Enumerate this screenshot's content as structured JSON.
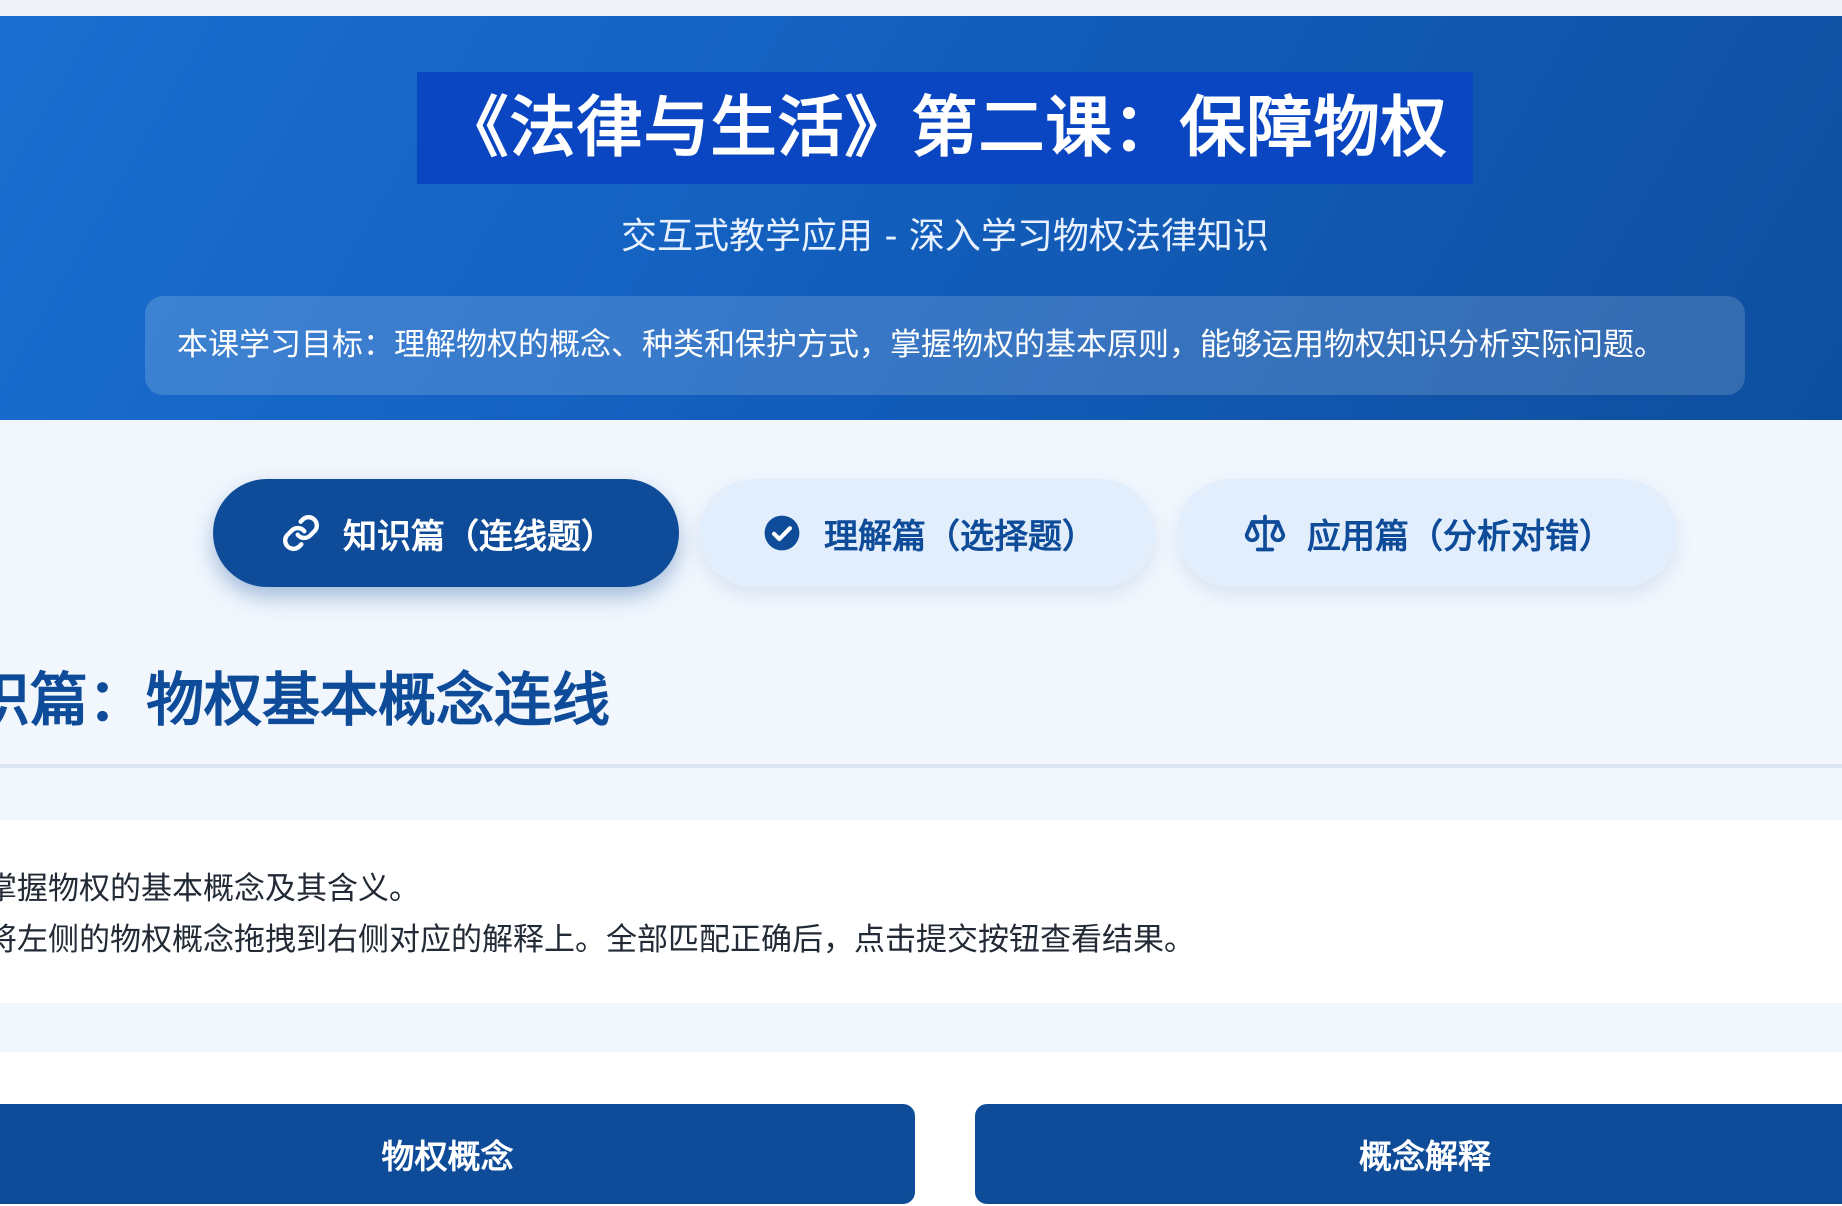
{
  "header": {
    "title": "《法律与生活》第二课：保障物权",
    "subtitle": "交互式教学应用 - 深入学习物权法律知识",
    "goal": "本课学习目标：理解物权的概念、种类和保护方式，掌握物权的基本原则，能够运用物权知识分析实际问题。"
  },
  "tabs": [
    {
      "label": "知识篇（连线题）",
      "icon": "link-icon",
      "active": true
    },
    {
      "label": "理解篇（选择题）",
      "icon": "check-circle-icon",
      "active": false
    },
    {
      "label": "应用篇（分析对错）",
      "icon": "scale-icon",
      "active": false
    }
  ],
  "section": {
    "title": "识篇：物权基本概念连线",
    "instruction_lines": [
      "掌握物权的基本概念及其含义。",
      "将左侧的物权概念拖拽到右侧对应的解释上。全部匹配正确后，点击提交按钮查看结果。"
    ]
  },
  "matching": {
    "left_header": "物权概念",
    "right_header": "概念解释"
  },
  "colors": {
    "primary": "#0e4c99",
    "header_gradient_start": "#1a6fd0",
    "header_gradient_end": "#0e4e9e",
    "title_highlight": "#0a46c2",
    "tab_inactive_bg": "#e3eefc",
    "page_bg": "#f2f7fe"
  }
}
